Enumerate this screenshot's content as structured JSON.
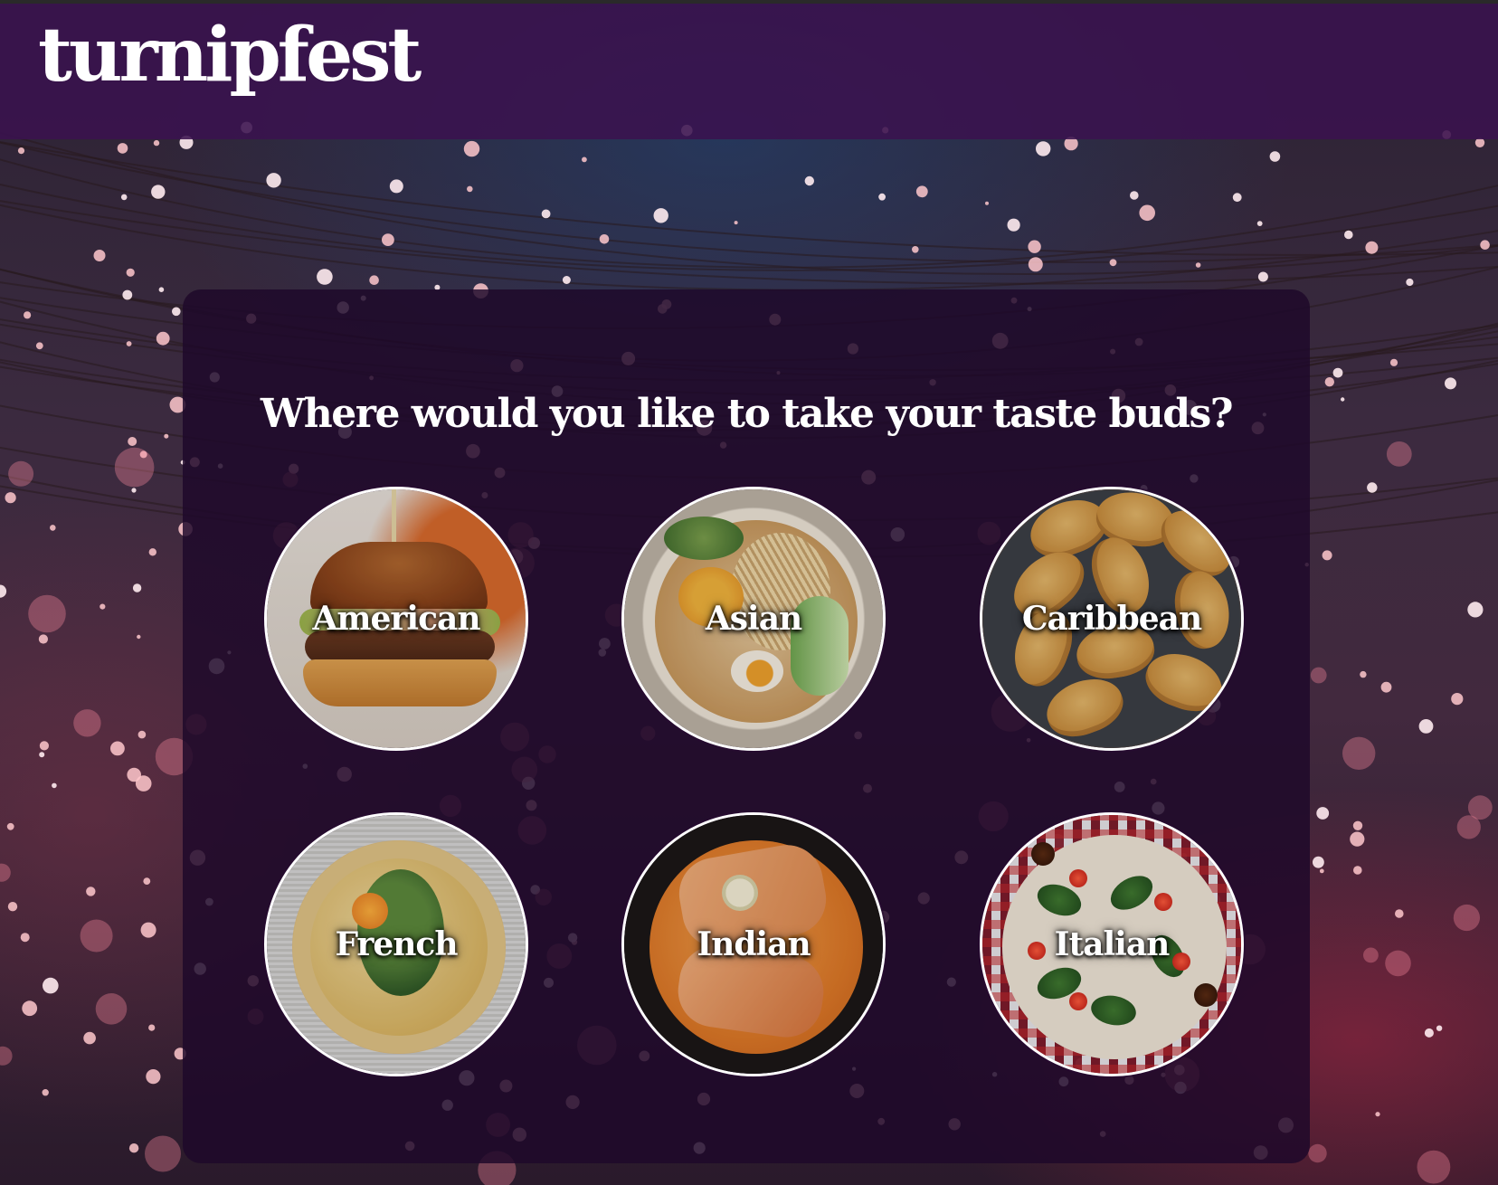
{
  "brand": {
    "name": "turnipfest"
  },
  "main": {
    "question": "Where would you like to take your taste buds?",
    "options": [
      {
        "label": "American",
        "image": "burger-photo"
      },
      {
        "label": "Asian",
        "image": "ramen-bowl-photo"
      },
      {
        "label": "Caribbean",
        "image": "patties-platter-photo"
      },
      {
        "label": "French",
        "image": "quiche-photo"
      },
      {
        "label": "Indian",
        "image": "fish-curry-photo"
      },
      {
        "label": "Italian",
        "image": "pizza-photo"
      }
    ]
  },
  "colors": {
    "header_bg": "#3a124e",
    "panel_bg": "#1e082a",
    "text": "#ffffff",
    "accent_lights": "#ffb6c8"
  }
}
